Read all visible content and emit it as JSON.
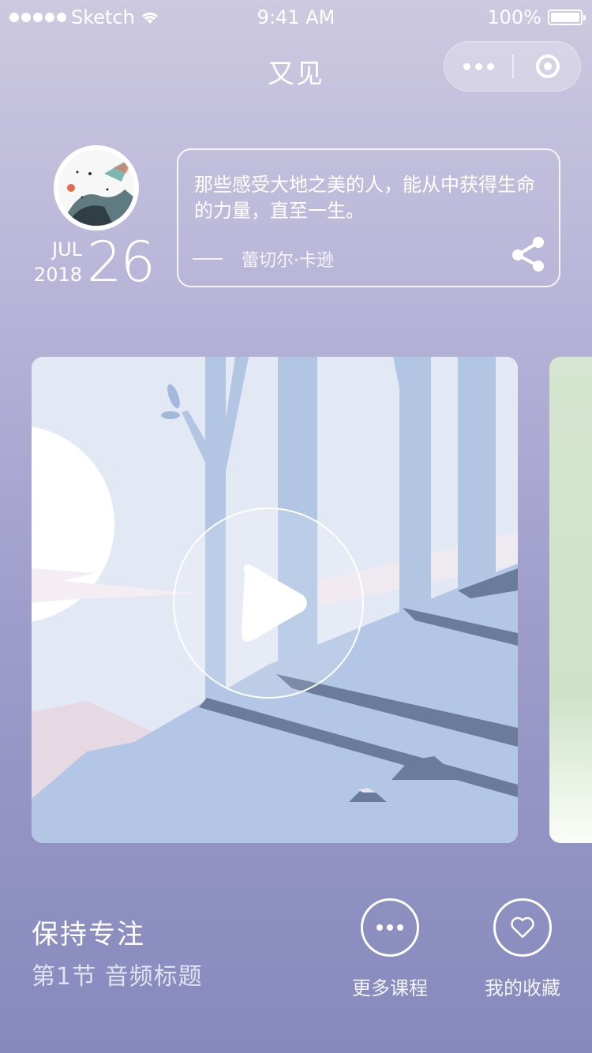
{
  "status_bar": {
    "carrier": "Sketch",
    "time": "9:41 AM",
    "battery": "100%"
  },
  "nav": {
    "title": "又见",
    "more_icon": "ellipsis-icon",
    "close_icon": "target-icon"
  },
  "daily": {
    "month": "JUL",
    "year": "2018",
    "day": "26",
    "quote": "那些感受大地之美的人，能从中获得生命的力量，直至一生。",
    "author": "蕾切尔·卡逊",
    "share_icon": "share-icon"
  },
  "card": {
    "play_icon": "play-icon"
  },
  "course": {
    "title": "保持专注",
    "subtitle": "第1节  音频标题"
  },
  "actions": [
    {
      "label": "更多课程",
      "icon": "ellipsis-icon"
    },
    {
      "label": "我的收藏",
      "icon": "heart-icon"
    }
  ],
  "colors": {
    "bg_top": "#cdc9e0",
    "bg_bottom": "#8789bd",
    "illustration_sky": "#e3e9f4",
    "illustration_ground": "#b4c6e5",
    "illustration_shadow": "#6a7b9c"
  }
}
